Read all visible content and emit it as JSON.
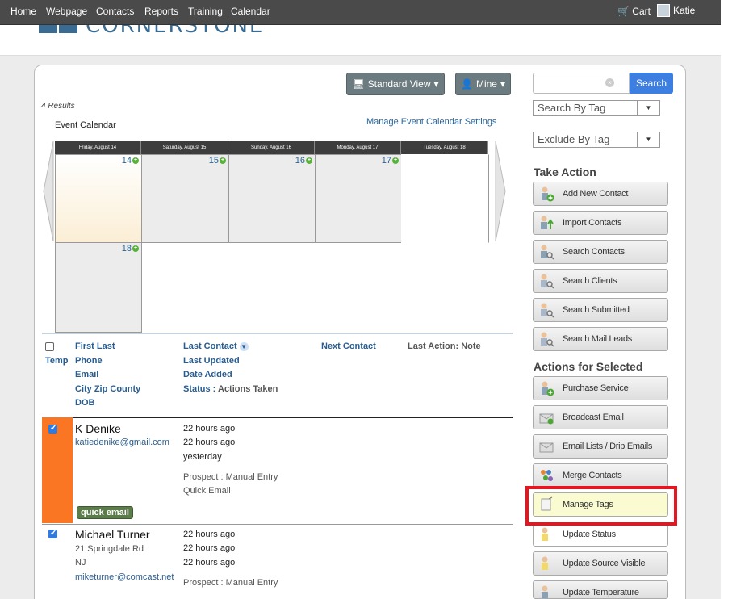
{
  "nav": {
    "items": [
      "Home",
      "Webpage",
      "Contacts",
      "Reports",
      "Training",
      "Calendar"
    ],
    "cart": "Cart",
    "user": "Katie"
  },
  "logo": {
    "text": "CORNERSTONE"
  },
  "toolbar": {
    "standard_view": "Standard View",
    "mine": "Mine"
  },
  "results": "4 Results",
  "calendar": {
    "title": "Event Calendar",
    "settings_link": "Manage Event Calendar Settings",
    "days": [
      "Friday, August 14",
      "Saturday, August 15",
      "Sunday, August 16",
      "Monday, August 17",
      "Tuesday, August 18"
    ],
    "dates": [
      "14",
      "15",
      "16",
      "17",
      "18"
    ]
  },
  "table_header": {
    "temp": "Temp",
    "col1": [
      "First Last",
      "Phone",
      "Email",
      "City Zip County",
      "DOB"
    ],
    "last_contact": "Last Contact",
    "last_updated": "Last Updated",
    "date_added": "Date Added",
    "status": "Status :",
    "actions_taken": "Actions Taken",
    "next_contact": "Next Contact",
    "last_action": "Last Action: Note"
  },
  "contacts": [
    {
      "name": "K Denike",
      "email": "katiedenike@gmail.com",
      "last_contact": "22 hours ago",
      "last_updated": "22 hours ago",
      "date_added": "yesterday",
      "status": "Prospect : Manual Entry",
      "action": "Quick Email",
      "badge": "quick email"
    },
    {
      "name": "Michael Turner",
      "address": "21 Springdale Rd",
      "state": "NJ",
      "email": "miketurner@comcast.net",
      "last_contact": "22 hours ago",
      "last_updated": "22 hours ago",
      "date_added": "22 hours ago",
      "status": "Prospect : Manual Entry"
    }
  ],
  "sidebar": {
    "search_button": "Search",
    "search_by_tag": "Search By Tag",
    "exclude_by_tag": "Exclude By Tag",
    "take_action_title": "Take Action",
    "take_action": [
      "Add New Contact",
      "Import Contacts",
      "Search Contacts",
      "Search Clients",
      "Search Submitted",
      "Search Mail Leads"
    ],
    "selected_title": "Actions for Selected",
    "selected_actions": [
      "Purchase Service",
      "Broadcast Email",
      "Email Lists / Drip Emails",
      "Merge Contacts",
      "Manage Tags",
      "Update Status",
      "Update Source Visible",
      "Update Temperature"
    ]
  },
  "colors": {
    "nav_bg": "#4a4a4a",
    "link": "#2a5d8f",
    "selected_row": "#fa7622",
    "search_btn": "#3d7fe0",
    "highlight_border": "#e8151f"
  }
}
